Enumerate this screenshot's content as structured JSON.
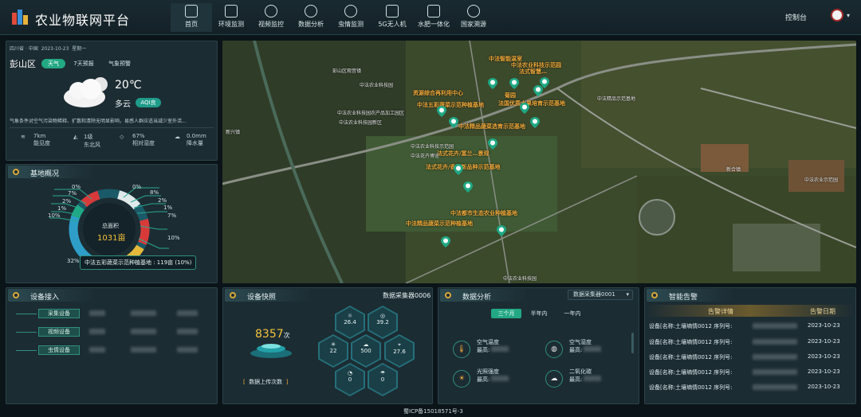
{
  "header": {
    "title": "农业物联网平台",
    "nav": [
      {
        "label": "首页",
        "icon": "home-icon"
      },
      {
        "label": "环境监测",
        "icon": "cube-icon"
      },
      {
        "label": "视频监控",
        "icon": "camera-icon"
      },
      {
        "label": "数据分析",
        "icon": "chart-icon"
      },
      {
        "label": "虫情监测",
        "icon": "bug-icon"
      },
      {
        "label": "5G无人机",
        "icon": "drone-icon"
      },
      {
        "label": "水肥一体化",
        "icon": "water-icon"
      },
      {
        "label": "国家溯源",
        "icon": "search-icon"
      }
    ],
    "console": "控制台"
  },
  "weather": {
    "location": "四川省 · 中国",
    "date": "2023-10-23",
    "weekday": "星期一",
    "district": "彭山区",
    "tabs": [
      "天气",
      "7天预报",
      "气象预警"
    ],
    "temp": "20℃",
    "condition": "多云",
    "aqi": "AQI良",
    "note": "气象条件对空气污染物稀释、扩散和清除无明显影响，易感人群应适当减少室外活...",
    "stats": [
      {
        "value": "7km",
        "label": "能见度"
      },
      {
        "value": "1级",
        "label": "东北风"
      },
      {
        "value": "67%",
        "label": "相对湿度"
      },
      {
        "value": "0.0mm",
        "label": "降水量"
      }
    ]
  },
  "base": {
    "title": "基地概况",
    "center_label": "总面积",
    "center_value": "1031亩",
    "tooltip": "中法五彩蔬菜示范种植基地 : 119亩 (10%)",
    "left_pcts": [
      "0%",
      "7%",
      "2%",
      "1%",
      "10%",
      "32%"
    ],
    "right_pcts": [
      "0%",
      "8%",
      "2%",
      "1%",
      "7%",
      "10%"
    ]
  },
  "devices": {
    "title": "设备接入",
    "items": [
      "采集设备",
      "视频设备",
      "虫情设备"
    ]
  },
  "snapshot": {
    "title": "设备快照",
    "source": "数据采集器0006",
    "count": "8357",
    "count_unit": "次",
    "count_label": "数据上传次数",
    "hex_values": [
      "26.4",
      "39.2",
      "22",
      "500",
      "27.6",
      "0",
      "0"
    ]
  },
  "analysis": {
    "title": "数据分析",
    "select": "数据采集器0001",
    "tabs": [
      "三个月",
      "半年内",
      "一年内"
    ],
    "metrics": [
      {
        "name": "空气温度",
        "prefix": "最高:"
      },
      {
        "name": "空气湿度",
        "prefix": "最高:"
      },
      {
        "name": "光照强度",
        "prefix": "最高:"
      },
      {
        "name": "二氧化碳",
        "prefix": "最高:"
      }
    ]
  },
  "alerts": {
    "title": "智能告警",
    "col_detail": "告警详情",
    "col_date": "告警日期",
    "rows": [
      {
        "text": "设备[名称:土壤墒情0012 序列号:",
        "date": "2023-10-23"
      },
      {
        "text": "设备[名称:土壤墒情0012 序列号:",
        "date": "2023-10-23"
      },
      {
        "text": "设备[名称:土壤墒情0012 序列号:",
        "date": "2023-10-23"
      },
      {
        "text": "设备[名称:土壤墒情0012 序列号:",
        "date": "2023-10-23"
      },
      {
        "text": "设备[名称:土壤墒情0012 序列号:",
        "date": "2023-10-23"
      }
    ]
  },
  "map": {
    "orange_labels": [
      "中法智能温室",
      "中法农业科技示范园",
      "法式智慧…",
      "资源综合再利用中心",
      "菊园",
      "中法五彩蔬菜示范种植基地",
      "法国优质水果培育示范基地",
      "中法精品蔬菜选育示范基地",
      "法式花卉/富兰…景观",
      "法式花卉/香草新品种示范基地",
      "中法都市生态农业种植基地",
      "中法精品蔬菜示范种植基地"
    ],
    "white_labels": [
      "彭山区观音镇",
      "中法农业科技园",
      "中法农业科技园农产品加工园区",
      "中法农业科技园新区",
      "中法农业科技示范园",
      "中法花卉博览",
      "中法精品示范基地",
      "新兴镇",
      "新合镇",
      "中法农业示范园",
      "中法农业科技园"
    ]
  },
  "footer": "蜀ICP备15018571号-3"
}
